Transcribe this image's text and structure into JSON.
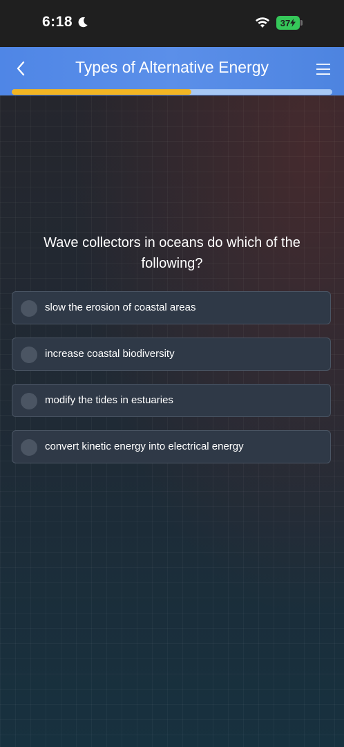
{
  "status_bar": {
    "time": "6:18",
    "battery": "37"
  },
  "header": {
    "title": "Types of Alternative Energy",
    "progress_fraction": 0.56
  },
  "quiz": {
    "question": "Wave collectors in oceans do which of the following?",
    "options": [
      {
        "label": "slow the erosion of coastal areas"
      },
      {
        "label": "increase coastal biodiversity"
      },
      {
        "label": "modify the tides in estuaries"
      },
      {
        "label": "convert kinetic energy into electrical energy"
      }
    ]
  },
  "colors": {
    "header_blue": "#5b8fe9",
    "progress_fill": "#f2b523",
    "progress_track": "#a7c8f5",
    "battery_green": "#35c759",
    "option_background": "#2f3947"
  },
  "icons": {
    "back": "chevron-left-icon",
    "menu": "hamburger-menu-icon",
    "wifi": "wifi-icon",
    "moon": "moon-icon"
  }
}
